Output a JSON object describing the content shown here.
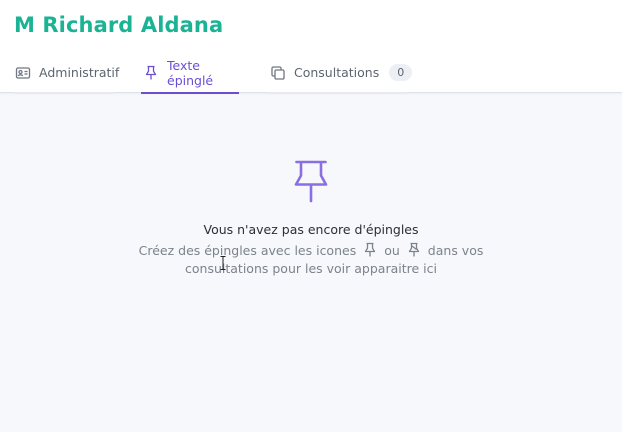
{
  "patient": {
    "name": "M Richard Aldana"
  },
  "tabs": [
    {
      "label": "Administratif",
      "icon": "id-card-icon",
      "active": false
    },
    {
      "label": "Texte épinglé",
      "icon": "pin-icon",
      "active": true
    },
    {
      "label": "Consultations",
      "icon": "copy-icon",
      "active": false,
      "count": "0"
    }
  ],
  "empty_state": {
    "icon": "pin-icon",
    "title": "Vous n'avez pas encore d'épingles",
    "text_before": "Créez des épingles avec les icones",
    "text_or": "ou",
    "text_after": "dans vos",
    "text_line2": "consultations pour les voir apparaitre ici",
    "inline_icon_1": "pin-icon",
    "inline_icon_2": "pin-slash-icon"
  },
  "colors": {
    "brand": "#1ab394",
    "accent": "#6b4fd0",
    "text_muted": "#7c838c",
    "background": "#f6f8fb"
  }
}
